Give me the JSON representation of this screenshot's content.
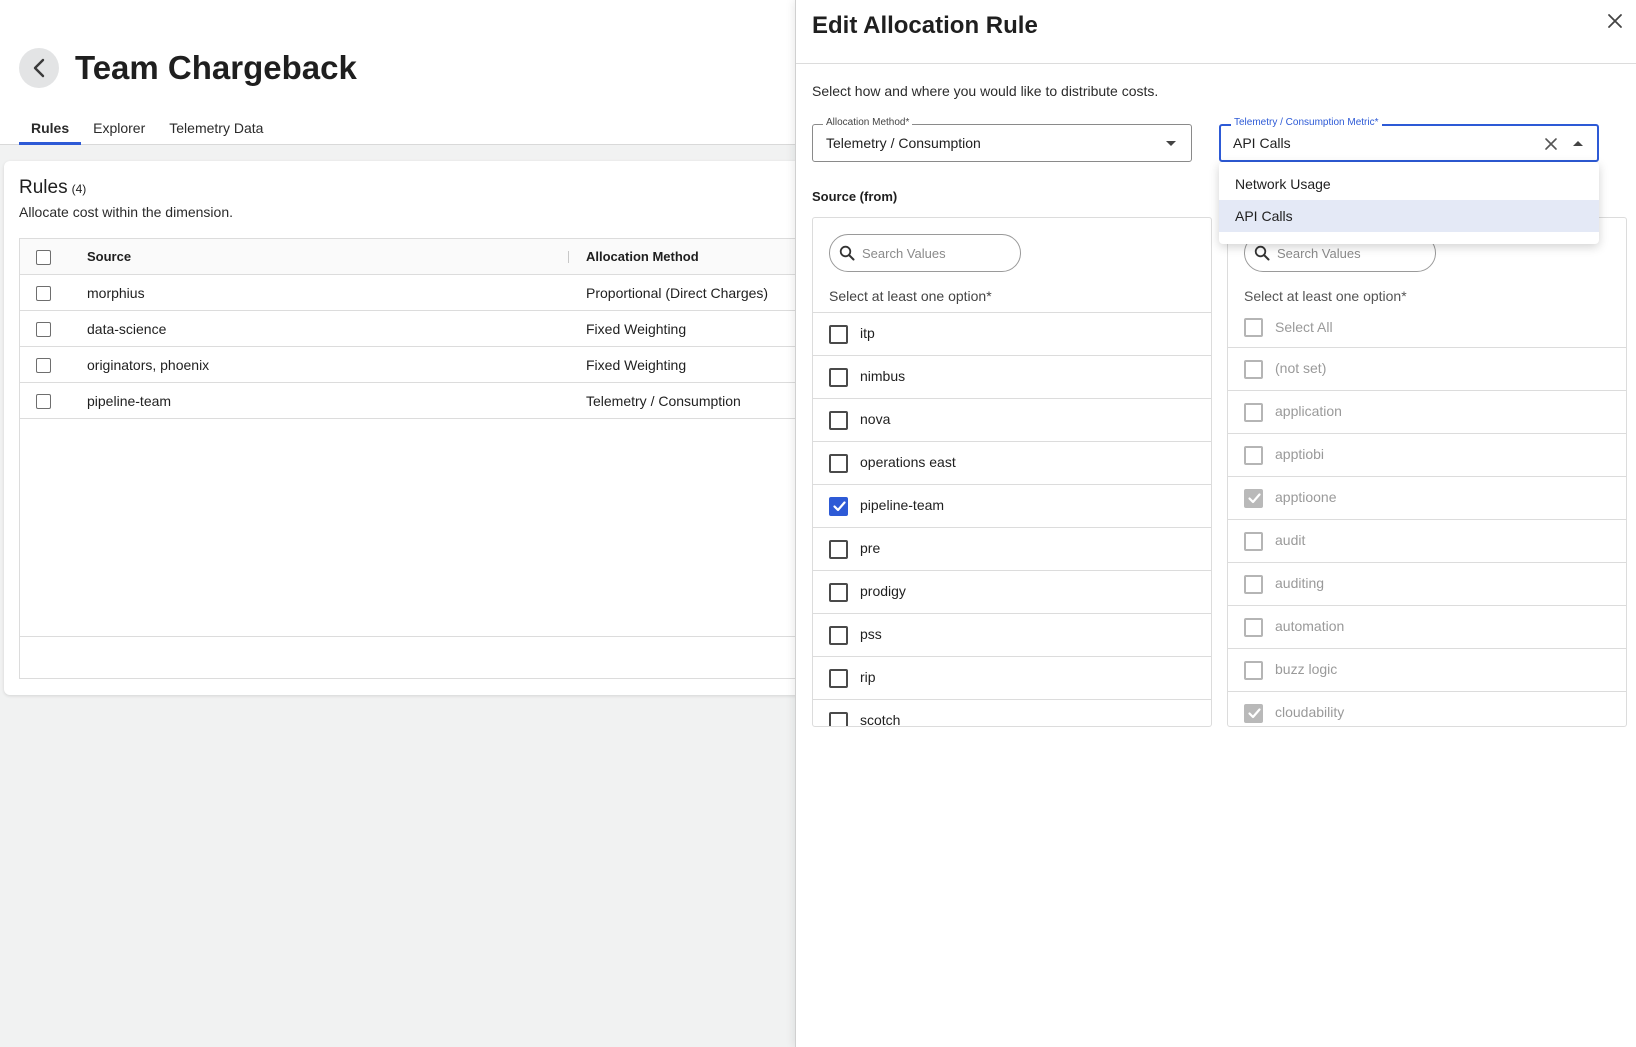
{
  "page": {
    "title": "Team Chargeback",
    "tabs": [
      {
        "label": "Rules",
        "active": true
      },
      {
        "label": "Explorer",
        "active": false
      },
      {
        "label": "Telemetry Data",
        "active": false
      }
    ],
    "rules": {
      "title": "Rules",
      "count": "(4)",
      "subtitle": "Allocate cost within the dimension.",
      "columns": [
        "Source",
        "Allocation Method"
      ],
      "rows": [
        {
          "source": "morphius",
          "method": "Proportional (Direct Charges)"
        },
        {
          "source": "data-science",
          "method": "Fixed Weighting"
        },
        {
          "source": "originators, phoenix",
          "method": "Fixed Weighting"
        },
        {
          "source": "pipeline-team",
          "method": "Telemetry / Consumption"
        }
      ]
    }
  },
  "drawer": {
    "title": "Edit Allocation Rule",
    "description": "Select how and where you would like to distribute costs.",
    "allocation_method": {
      "label": "Allocation Method",
      "required_mark": "*",
      "value": "Telemetry / Consumption"
    },
    "metric": {
      "label": "Telemetry / Consumption Metric",
      "required_mark": "*",
      "value": "API Calls",
      "options": [
        {
          "label": "Network Usage",
          "selected": false
        },
        {
          "label": "API Calls",
          "selected": true
        }
      ]
    },
    "source": {
      "label": "Source (from)",
      "search_placeholder": "Search Values",
      "hint": "Select at least one option",
      "required_mark": "*",
      "items": [
        {
          "label": "itp",
          "checked": false
        },
        {
          "label": "nimbus",
          "checked": false
        },
        {
          "label": "nova",
          "checked": false
        },
        {
          "label": "operations east",
          "checked": false
        },
        {
          "label": "pipeline-team",
          "checked": true
        },
        {
          "label": "pre",
          "checked": false
        },
        {
          "label": "prodigy",
          "checked": false
        },
        {
          "label": "pss",
          "checked": false
        },
        {
          "label": "rip",
          "checked": false
        },
        {
          "label": "scotch",
          "checked": false
        }
      ]
    },
    "target": {
      "search_placeholder": "Search Values",
      "hint": "Select at least one option",
      "required_mark": "*",
      "items": [
        {
          "label": "Select All",
          "checked": false
        },
        {
          "label": "(not set)",
          "checked": false
        },
        {
          "label": "application",
          "checked": false
        },
        {
          "label": "apptiobi",
          "checked": false
        },
        {
          "label": "apptioone",
          "checked": true
        },
        {
          "label": "audit",
          "checked": false
        },
        {
          "label": "auditing",
          "checked": false
        },
        {
          "label": "automation",
          "checked": false
        },
        {
          "label": "buzz logic",
          "checked": false
        },
        {
          "label": "cloudability",
          "checked": true
        }
      ]
    }
  },
  "colors": {
    "accent": "#2d5ad6",
    "selected_bg": "#e4e9f6",
    "disabled_text": "#9a9a9a"
  },
  "icons": [
    "chevron-left-icon",
    "close-icon",
    "caret-down-icon",
    "caret-up-icon",
    "clear-icon",
    "search-icon",
    "checkmark-icon"
  ]
}
